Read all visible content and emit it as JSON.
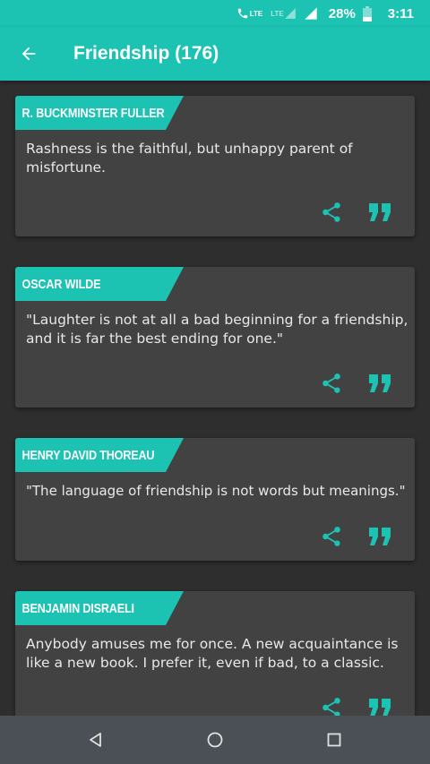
{
  "status_bar": {
    "signal_label": "LTE",
    "signal2_label": "LTE",
    "battery": "28%",
    "time": "3:11"
  },
  "app_bar": {
    "title": "Friendship (176)",
    "back_icon": "arrow-back-icon"
  },
  "colors": {
    "accent": "#1cc2b2",
    "card": "#424242",
    "background": "#2e2e2e",
    "navbar": "#4b4f56"
  },
  "quotes": [
    {
      "author": "R. BUCKMINSTER FULLER",
      "text": "Rashness is the faithful, but unhappy parent of misfortune."
    },
    {
      "author": "OSCAR WILDE",
      "text": "\"Laughter is not at all a bad beginning for a friendship, and it is far the best ending for one.\""
    },
    {
      "author": "HENRY DAVID THOREAU",
      "text": "\"The language of friendship is not words but meanings.\""
    },
    {
      "author": "BENJAMIN DISRAELI",
      "text": "Anybody amuses me for once. A new acquaintance is like a new book. I prefer it, even if bad, to a classic."
    }
  ],
  "card_actions": [
    "share-icon",
    "quote-icon"
  ],
  "nav_bar": [
    "back-triangle-icon",
    "home-circle-icon",
    "recents-square-icon"
  ]
}
